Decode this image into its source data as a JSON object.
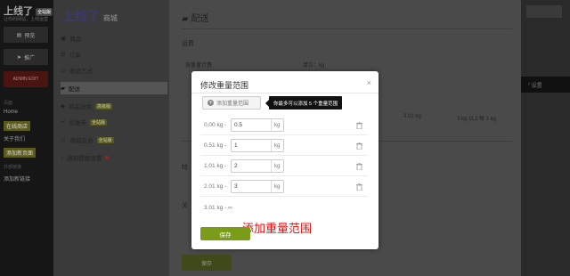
{
  "admin": {
    "brand": "上线了",
    "brand_tag": "全站版",
    "subtitle": "让你的网站，上线运营",
    "tiles": [
      "预览",
      "推广",
      "ADMIN EDIT"
    ],
    "nav_label": "页面",
    "nav": [
      "Home",
      "在线商店",
      "关于我们",
      "添加新页面"
    ],
    "nav_label2": "外部链接",
    "nav_ext": "添加新链接"
  },
  "store": {
    "logo": "上线了",
    "logo_sub": "商城",
    "items": [
      {
        "label": "商品"
      },
      {
        "label": "订单"
      },
      {
        "label": "收款方式"
      },
      {
        "label": "配送"
      },
      {
        "label": "商品分类",
        "badge": "高级版"
      },
      {
        "label": "优惠券",
        "badge": "全站版"
      },
      {
        "label": "商城会员",
        "badge": "全站版"
      },
      {
        "label": "通知提醒设置"
      }
    ]
  },
  "main": {
    "title": "配送",
    "section1": "运费",
    "select1": "按重量计费",
    "select2": "单位：kg",
    "cell1": "3.01 kg",
    "cell2": "3 kg 以上每 1 kg",
    "section2": "特",
    "section3": "关",
    "bottom_button": "保存",
    "right_button": "设置"
  },
  "modal": {
    "title": "修改重量范围",
    "add_button": "添加重量范围",
    "tooltip": "你最多可以添加 5 个重量范围",
    "rows": [
      {
        "from": "0.00 kg -",
        "value": "0.5",
        "unit": "kg"
      },
      {
        "from": "0.51 kg -",
        "value": "1",
        "unit": "kg"
      },
      {
        "from": "1.01 kg -",
        "value": "2",
        "unit": "kg"
      },
      {
        "from": "2.01 kg -",
        "value": "3",
        "unit": "kg"
      }
    ],
    "last_row": "3.01 kg - ∞",
    "annotation": "添加重量范围",
    "save": "保存"
  }
}
